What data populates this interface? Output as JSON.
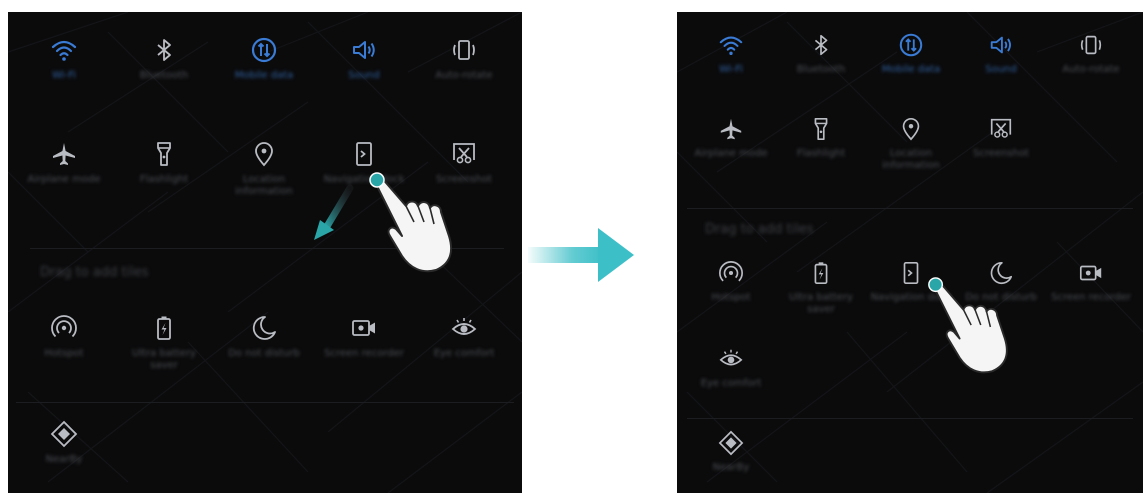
{
  "colors": {
    "accent": "#3a7bd5",
    "icon_dim": "#b9bcc2",
    "touch_dot": "#2aa6a8",
    "transition_arrow": "#3dbfc7"
  },
  "left_panel": {
    "active_tiles": [
      {
        "icon": "wifi-icon",
        "label": "Wi-Fi",
        "on": true
      },
      {
        "icon": "bluetooth-icon",
        "label": "Bluetooth",
        "on": false
      },
      {
        "icon": "mobile-data-icon",
        "label": "Mobile data",
        "on": true
      },
      {
        "icon": "sound-icon",
        "label": "Sound",
        "on": true
      },
      {
        "icon": "auto-rotate-icon",
        "label": "Auto-rotate",
        "on": false
      },
      {
        "icon": "airplane-icon",
        "label": "Airplane mode",
        "on": false
      },
      {
        "icon": "flashlight-icon",
        "label": "Flashlight",
        "on": false
      },
      {
        "icon": "location-icon",
        "label": "Location information",
        "on": false
      },
      {
        "icon": "navigation-dock-icon",
        "label": "Navigation dock",
        "on": false
      },
      {
        "icon": "screenshot-icon",
        "label": "Screenshot",
        "on": false
      }
    ],
    "section_title": "Drag to add tiles",
    "extra_tiles": [
      {
        "icon": "hotspot-icon",
        "label": "Hotspot"
      },
      {
        "icon": "battery-saver-icon",
        "label": "Ultra battery saver"
      },
      {
        "icon": "moon-icon",
        "label": "Do not disturb"
      },
      {
        "icon": "screen-recorder-icon",
        "label": "Screen recorder"
      },
      {
        "icon": "eye-icon",
        "label": "Eye comfort"
      },
      {
        "icon": "nearby-icon",
        "label": "NearBy"
      }
    ]
  },
  "right_panel": {
    "active_tiles": [
      {
        "icon": "wifi-icon",
        "label": "Wi-Fi",
        "on": true
      },
      {
        "icon": "bluetooth-icon",
        "label": "Bluetooth",
        "on": false
      },
      {
        "icon": "mobile-data-icon",
        "label": "Mobile data",
        "on": true
      },
      {
        "icon": "sound-icon",
        "label": "Sound",
        "on": true
      },
      {
        "icon": "auto-rotate-icon",
        "label": "Auto-rotate",
        "on": false
      },
      {
        "icon": "airplane-icon",
        "label": "Airplane mode",
        "on": false
      },
      {
        "icon": "flashlight-icon",
        "label": "Flashlight",
        "on": false
      },
      {
        "icon": "location-icon",
        "label": "Location information",
        "on": false
      },
      {
        "icon": "screenshot-icon",
        "label": "Screenshot",
        "on": false
      }
    ],
    "section_title": "Drag to add tiles",
    "extra_tiles": [
      {
        "icon": "hotspot-icon",
        "label": "Hotspot"
      },
      {
        "icon": "battery-saver-icon",
        "label": "Ultra battery saver"
      },
      {
        "icon": "navigation-dock-icon",
        "label": "Navigation dock"
      },
      {
        "icon": "moon-icon",
        "label": "Do not disturb"
      },
      {
        "icon": "screen-recorder-icon",
        "label": "Screen recorder"
      },
      {
        "icon": "eye-icon",
        "label": "Eye comfort"
      },
      {
        "icon": "nearby-icon",
        "label": "NearBy"
      }
    ]
  }
}
